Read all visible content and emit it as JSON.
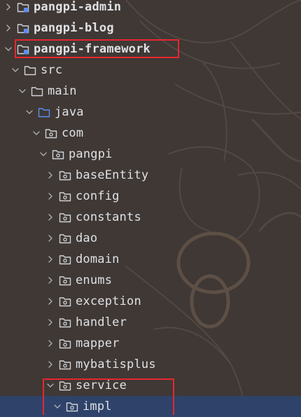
{
  "project_tree": {
    "items": [
      {
        "label": "pangpi-admin",
        "expanded": false,
        "module": true,
        "bold": true
      },
      {
        "label": "pangpi-blog",
        "expanded": false,
        "module": true,
        "bold": true
      },
      {
        "label": "pangpi-framework",
        "expanded": true,
        "module": true,
        "bold": true,
        "highlighted": true
      },
      {
        "label": "src",
        "expanded": true,
        "icon": "folder-icon"
      },
      {
        "label": "main",
        "expanded": true,
        "icon": "folder-icon"
      },
      {
        "label": "java",
        "expanded": true,
        "icon": "source-root-folder-icon"
      },
      {
        "label": "com",
        "expanded": true,
        "icon": "package-icon"
      },
      {
        "label": "pangpi",
        "expanded": true,
        "icon": "package-icon"
      },
      {
        "label": "baseEntity",
        "expanded": false,
        "icon": "package-icon"
      },
      {
        "label": "config",
        "expanded": false,
        "icon": "package-icon"
      },
      {
        "label": "constants",
        "expanded": false,
        "icon": "package-icon"
      },
      {
        "label": "dao",
        "expanded": false,
        "icon": "package-icon"
      },
      {
        "label": "domain",
        "expanded": false,
        "icon": "package-icon"
      },
      {
        "label": "enums",
        "expanded": false,
        "icon": "package-icon"
      },
      {
        "label": "exception",
        "expanded": false,
        "icon": "package-icon"
      },
      {
        "label": "handler",
        "expanded": false,
        "icon": "package-icon"
      },
      {
        "label": "mapper",
        "expanded": false,
        "icon": "package-icon"
      },
      {
        "label": "mybatisplus",
        "expanded": false,
        "icon": "package-icon"
      },
      {
        "label": "service",
        "expanded": true,
        "icon": "package-icon",
        "highlighted": true
      },
      {
        "label": "impl",
        "expanded": true,
        "icon": "package-icon",
        "selected": true,
        "highlighted": true
      }
    ]
  },
  "colors": {
    "background": "#3f3835",
    "text": "#dfe1e5",
    "selection": "#2e436e",
    "highlight_box": "#e8262f",
    "folder_outline": "#cfd2d6",
    "source_root": "#5d8ef0",
    "module_badge": "#5d8ef0"
  }
}
